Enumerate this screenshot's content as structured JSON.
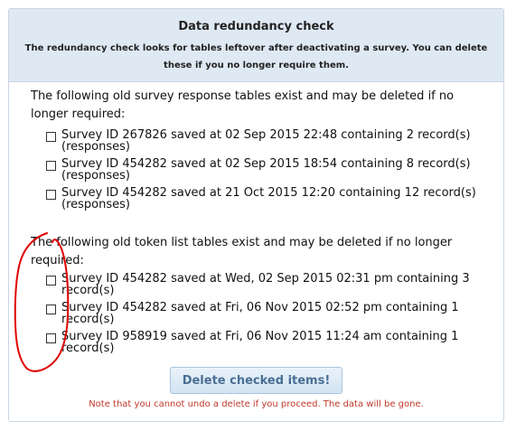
{
  "panel": {
    "title": "Data redundancy check",
    "description": "The redundancy check looks for tables leftover after deactivating a survey. You can delete these if you no longer require them."
  },
  "response_section": {
    "heading": "The following old survey response tables exist and may be deleted if no longer required:",
    "items": [
      {
        "label": "Survey ID 267826 saved at 02 Sep 2015 22:48 containing 2 record(s) (responses)",
        "checked": false
      },
      {
        "label": "Survey ID 454282 saved at 02 Sep 2015 18:54 containing 8 record(s) (responses)",
        "checked": false
      },
      {
        "label": "Survey ID 454282 saved at 21 Oct 2015 12:20 containing 12 record(s) (responses)",
        "checked": false
      }
    ]
  },
  "token_section": {
    "heading": "The following old token list tables exist and may be deleted if no longer required:",
    "items": [
      {
        "label": "Survey ID 454282 saved at Wed, 02 Sep 2015 02:31 pm containing 3 record(s)",
        "checked": false
      },
      {
        "label": "Survey ID 454282 saved at Fri, 06 Nov 2015 02:52 pm containing 1 record(s)",
        "checked": false
      },
      {
        "label": "Survey ID 958919 saved at Fri, 06 Nov 2015 11:24 am containing 1 record(s)",
        "checked": false
      }
    ]
  },
  "actions": {
    "delete_label": "Delete checked items!",
    "warning": "Note that you cannot undo a delete if you proceed. The data will be gone."
  },
  "colors": {
    "header_bg": "#dfe9f4",
    "warning": "#c0392b",
    "annotation": "#e00000"
  }
}
